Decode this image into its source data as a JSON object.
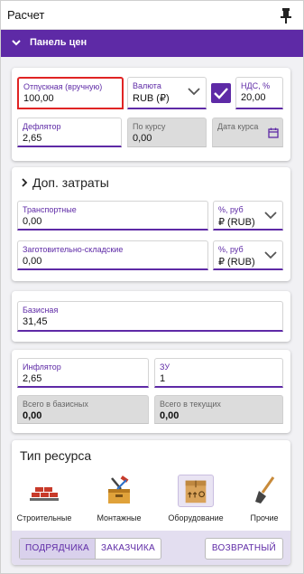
{
  "window": {
    "title": "Расчет"
  },
  "panel": {
    "title": "Панель цен"
  },
  "prices": {
    "release_price": {
      "label": "Отпускная (вручную)",
      "value": "100,00"
    },
    "currency": {
      "label": "Валюта",
      "value": "RUB (₽)"
    },
    "vat_checkbox": {
      "checked": true
    },
    "vat": {
      "label": "НДС, %",
      "value": "20,00"
    },
    "deflator": {
      "label": "Дефлятор",
      "value": "2,65"
    },
    "by_rate": {
      "label": "По курсу",
      "value": "0,00"
    },
    "rate_date": {
      "label": "Дата курса",
      "value": ""
    }
  },
  "extra_costs": {
    "title": "Доп. затраты",
    "transport": {
      "label": "Транспортные",
      "value": "0,00"
    },
    "transport_unit": {
      "label": "%, руб",
      "value": "₽ (RUB)"
    },
    "storage": {
      "label": "Заготовительно-складские",
      "value": "0,00"
    },
    "storage_unit": {
      "label": "%, руб",
      "value": "₽ (RUB)"
    }
  },
  "base": {
    "label": "Базисная",
    "value": "31,45"
  },
  "totals": {
    "inflator": {
      "label": "Инфлятор",
      "value": "2,65"
    },
    "zu": {
      "label": "ЗУ",
      "value": "1"
    },
    "total_base": {
      "label": "Всего в базисных",
      "value": "0,00"
    },
    "total_current": {
      "label": "Всего в текущих",
      "value": "0,00"
    }
  },
  "resource_type": {
    "title": "Тип ресурса",
    "items": [
      {
        "label": "Строительные",
        "icon": "bricks-icon",
        "selected": false
      },
      {
        "label": "Монтажные",
        "icon": "toolbox-icon",
        "selected": false
      },
      {
        "label": "Оборудование",
        "icon": "box-icon",
        "selected": true
      },
      {
        "label": "Прочие",
        "icon": "shovel-icon",
        "selected": false
      }
    ]
  },
  "bottom": {
    "contractor": "ПОДРЯДЧИКА",
    "customer": "ЗАКАЗЧИКА",
    "returnable": "ВОЗВРАТНЫЙ"
  },
  "colors": {
    "accent": "#5e2aa6",
    "highlight": "#e02424",
    "disabled": "#dcdcdc"
  }
}
